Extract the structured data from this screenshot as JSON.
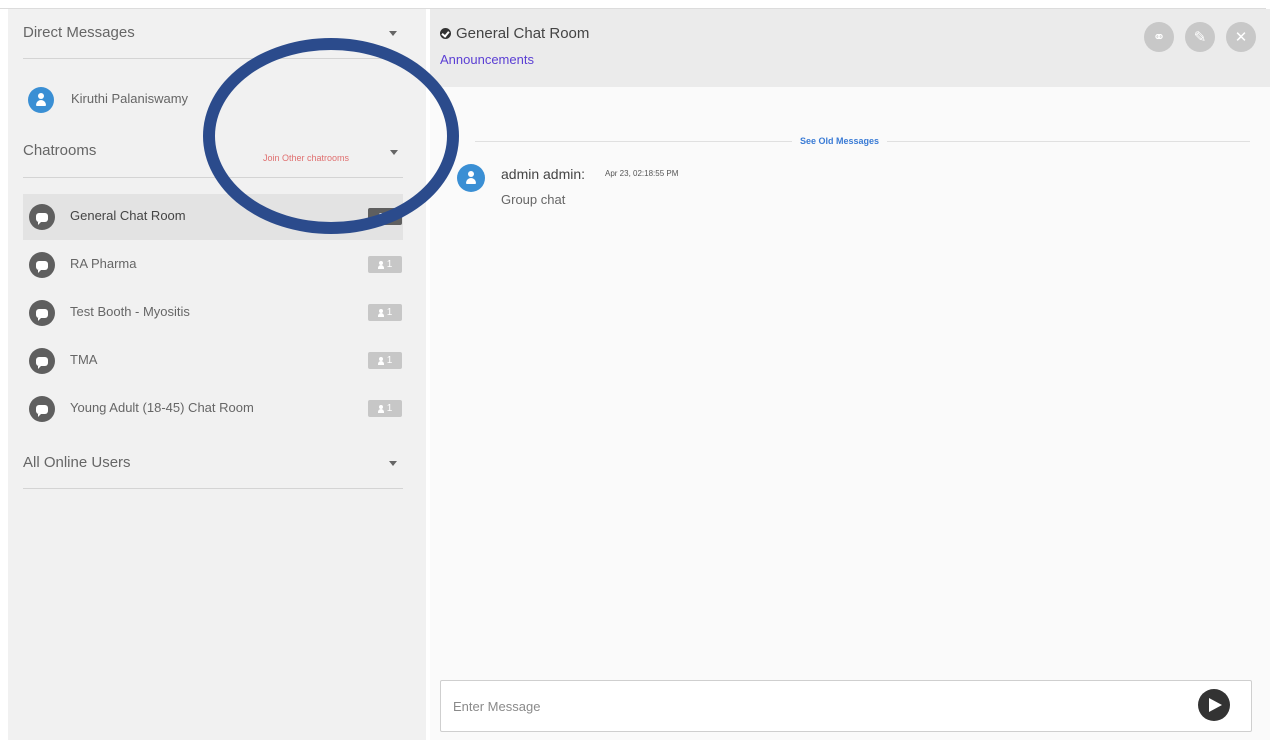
{
  "sidebar": {
    "direct_messages": {
      "label": "Direct Messages",
      "users": [
        {
          "name": "Kiruthi Palaniswamy"
        }
      ]
    },
    "chatrooms": {
      "label": "Chatrooms",
      "join_link": "Join Other chatrooms",
      "rooms": [
        {
          "name": "General Chat Room",
          "active": true,
          "badge_count": "1"
        },
        {
          "name": "RA Pharma",
          "active": false,
          "badge_count": "1"
        },
        {
          "name": "Test Booth - Myositis",
          "active": false,
          "badge_count": "1"
        },
        {
          "name": "TMA",
          "active": false,
          "badge_count": "1"
        },
        {
          "name": "Young Adult (18-45) Chat Room",
          "active": false,
          "badge_count": "1"
        }
      ]
    },
    "online_users": {
      "label": "All Online Users"
    }
  },
  "chat": {
    "title": "General Chat Room",
    "subtitle_link": "Announcements",
    "header_buttons": [
      {
        "name": "link-icon",
        "glyph": "⚭"
      },
      {
        "name": "edit-icon",
        "glyph": "✎"
      },
      {
        "name": "close-icon",
        "glyph": "✕"
      }
    ],
    "see_old_label": "See Old Messages",
    "messages": [
      {
        "author": "admin admin:",
        "time": "Apr 23, 02:18:55 PM",
        "text": "Group chat"
      }
    ],
    "input_placeholder": "Enter Message"
  },
  "colors": {
    "sidebar_bg": "#f1f1f1",
    "header_bg": "#ebebeb",
    "link": "#5b3fd4",
    "join_link": "#e07070",
    "avatar_blue": "#3a8fd4",
    "annotation_circle": "#2b4b8c"
  }
}
